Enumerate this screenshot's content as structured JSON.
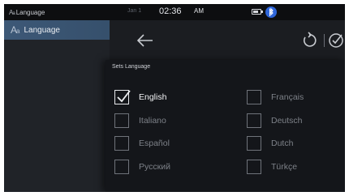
{
  "status_bar": {
    "app_title": "Language",
    "date": "Jan 1",
    "time": "02:36",
    "ampm": "AM",
    "icons": [
      "battery-icon",
      "bluetooth-icon"
    ]
  },
  "sidebar": {
    "items": [
      {
        "label": "Language",
        "icon": "language-icon",
        "selected": true
      }
    ]
  },
  "header": {
    "icons": [
      "back-arrow-icon",
      "undo-icon",
      "checkmark-icon"
    ]
  },
  "panel": {
    "title": "Sets Language",
    "languages": [
      {
        "label": "English",
        "checked": true
      },
      {
        "label": "Français",
        "checked": false
      },
      {
        "label": "Italiano",
        "checked": false
      },
      {
        "label": "Deutsch",
        "checked": false
      },
      {
        "label": "Español",
        "checked": false
      },
      {
        "label": "Dutch",
        "checked": false
      },
      {
        "label": "Русский",
        "checked": false
      },
      {
        "label": "Türkçe",
        "checked": false
      }
    ]
  },
  "colors": {
    "selected_item": "#3d5877",
    "background": "#1a1c20",
    "bluetooth": "#2f66d9"
  }
}
